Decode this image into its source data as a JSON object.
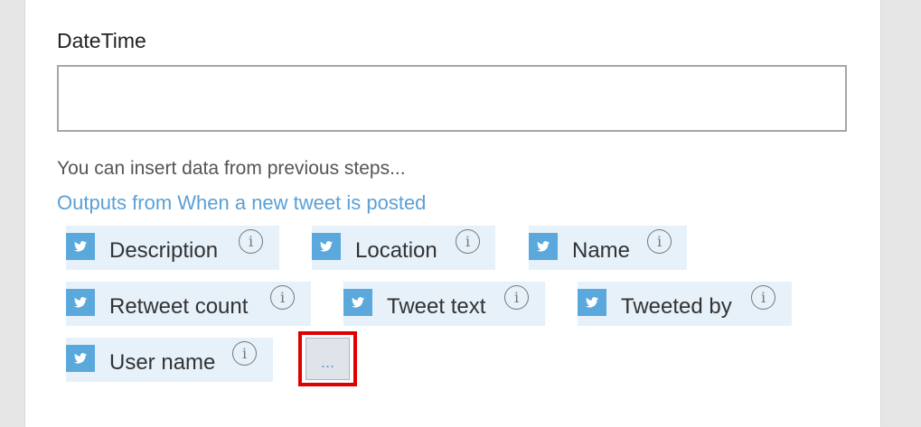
{
  "field": {
    "label": "DateTime",
    "value": "",
    "placeholder": ""
  },
  "hint": "You can insert data from previous steps...",
  "outputs_title": "Outputs from When a new tweet is posted",
  "tokens": [
    {
      "label": "Description",
      "icon": "twitter-icon"
    },
    {
      "label": "Location",
      "icon": "twitter-icon"
    },
    {
      "label": "Name",
      "icon": "twitter-icon"
    },
    {
      "label": "Retweet count",
      "icon": "twitter-icon"
    },
    {
      "label": "Tweet text",
      "icon": "twitter-icon"
    },
    {
      "label": "Tweeted by",
      "icon": "twitter-icon"
    },
    {
      "label": "User name",
      "icon": "twitter-icon"
    }
  ],
  "more_button": {
    "label": "..."
  },
  "colors": {
    "token_bg": "#e6f1fa",
    "twitter_icon_bg": "#5ba8dd",
    "link": "#5aa0d6",
    "highlight": "#e00000"
  }
}
